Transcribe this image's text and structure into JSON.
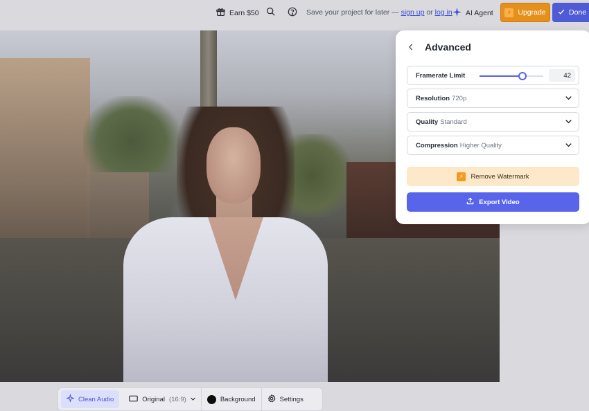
{
  "topbar": {
    "earn_label": "Earn $50",
    "save_prefix": "Save your project for later —",
    "signup_link": "sign up",
    "or_text": "or",
    "login_link": "log in",
    "ai_agent_label": "AI Agent",
    "upgrade_label": "Upgrade",
    "done_label": "Done",
    "icons": [
      "gift-icon",
      "search-icon",
      "help-icon",
      "sparkle-icon",
      "bolt-icon",
      "check-icon"
    ]
  },
  "panel": {
    "title": "Advanced",
    "framerate": {
      "label": "Framerate Limit",
      "value": "42",
      "slider_fraction": 0.67
    },
    "resolution": {
      "label": "Resolution",
      "value": "720p"
    },
    "quality": {
      "label": "Quality",
      "value": "Standard"
    },
    "compression": {
      "label": "Compression",
      "value": "Higher Quality"
    },
    "remove_watermark_label": "Remove Watermark",
    "export_label": "Export Video"
  },
  "bottombar": {
    "clean_audio_label": "Clean Audio",
    "aspect_label": "Original",
    "aspect_ratio": "(16:9)",
    "background_label": "Background",
    "settings_label": "Settings"
  },
  "colors": {
    "accent": "#5864ea",
    "upgrade": "#e6901c",
    "watermark_bg": "#fde9c9"
  }
}
